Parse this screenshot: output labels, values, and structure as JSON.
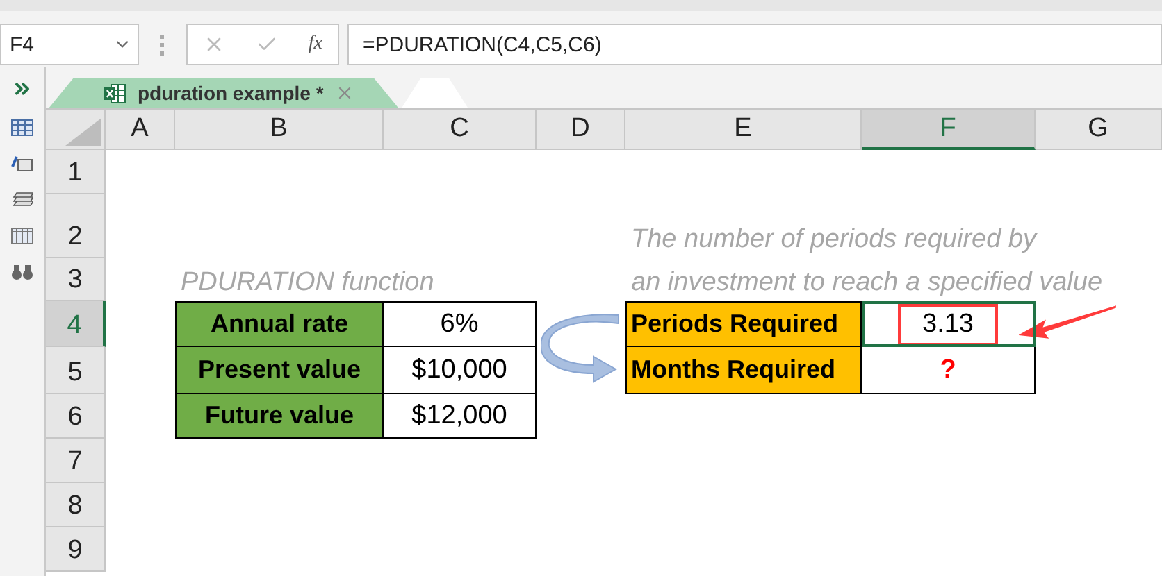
{
  "name_box": "F4",
  "function_button": "fx",
  "formula": "=PDURATION(C4,C5,C6)",
  "sheet_tabs": [
    {
      "label": "pduration example *",
      "selected": true
    }
  ],
  "columns": [
    {
      "label": "A",
      "selected": false
    },
    {
      "label": "B",
      "selected": false
    },
    {
      "label": "C",
      "selected": false
    },
    {
      "label": "D",
      "selected": false
    },
    {
      "label": "E",
      "selected": false
    },
    {
      "label": "F",
      "selected": true
    },
    {
      "label": "G",
      "selected": false
    }
  ],
  "rows": [
    {
      "label": "1",
      "selected": false
    },
    {
      "label": "2",
      "selected": false
    },
    {
      "label": "3",
      "selected": false
    },
    {
      "label": "4",
      "selected": true
    },
    {
      "label": "5",
      "selected": false
    },
    {
      "label": "6",
      "selected": false
    },
    {
      "label": "7",
      "selected": false
    },
    {
      "label": "8",
      "selected": false
    },
    {
      "label": "9",
      "selected": false
    }
  ],
  "input_title": "PDURATION function",
  "input_table": [
    {
      "label": "Annual rate",
      "value": "6%",
      "color": "#70ad47"
    },
    {
      "label": "Present value",
      "value": "$10,000",
      "color": "#70ad47"
    },
    {
      "label": "Future value",
      "value": "$12,000",
      "color": "#70ad47"
    }
  ],
  "note_lines": [
    "The number of periods required by",
    "an investment to reach a specified value"
  ],
  "result_table": [
    {
      "label": "Periods Required",
      "value": "3.13",
      "color": "#ffc000",
      "selected": true,
      "highlighted": true,
      "kind": "number"
    },
    {
      "label": "Months Required",
      "value": "?",
      "color": "#ffc000",
      "selected": false,
      "kind": "unknown"
    }
  ]
}
